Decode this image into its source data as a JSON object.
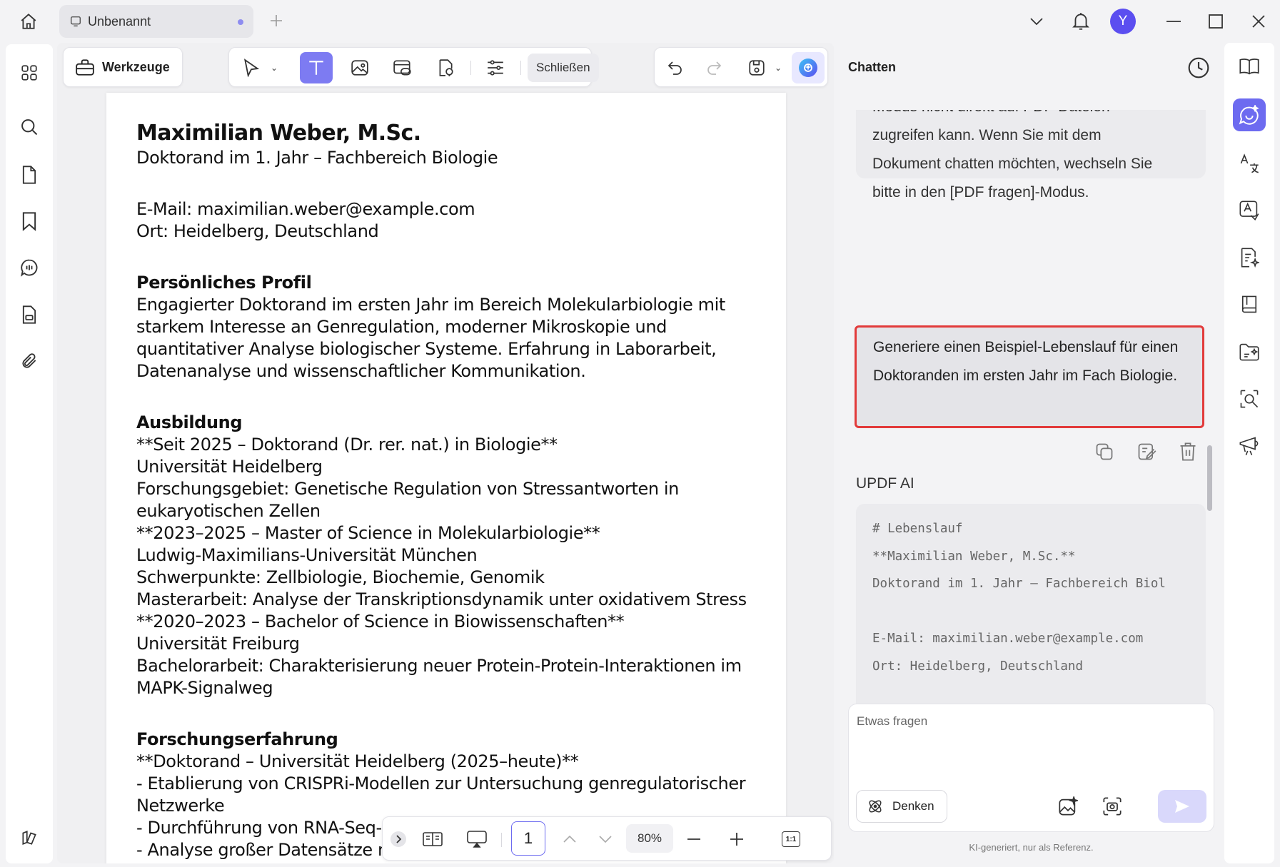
{
  "tab": {
    "title": "Unbenannt"
  },
  "topbar": {
    "avatar_letter": "Y"
  },
  "toolbar": {
    "tools_label": "Werkzeuge",
    "close_label": "Schließen"
  },
  "document": {
    "name": "Maximilian Weber, M.Sc.",
    "subtitle": "Doktorand im 1. Jahr – Fachbereich Biologie",
    "email": "E-Mail: maximilian.weber@example.com",
    "location": "Ort: Heidelberg, Deutschland",
    "profile_heading": "Persönliches Profil",
    "profile_lines": [
      "Engagierter Doktorand im ersten Jahr im Bereich Molekularbiologie mit",
      "starkem Interesse an Genregulation, moderner Mikroskopie und",
      "quantitativer Analyse biologischer Systeme. Erfahrung in Laborarbeit,",
      "Datenanalyse und wissenschaftlicher Kommunikation."
    ],
    "education_heading": "Ausbildung",
    "education_lines": [
      "**Seit 2025 – Doktorand (Dr. rer. nat.) in Biologie**",
      "Universität Heidelberg",
      "Forschungsgebiet: Genetische Regulation von Stressantworten in",
      "eukaryotischen Zellen",
      "**2023–2025 – Master of Science in Molekularbiologie**",
      "Ludwig-Maximilians-Universität München",
      "Schwerpunkte: Zellbiologie, Biochemie, Genomik",
      "Masterarbeit: Analyse der Transkriptionsdynamik unter oxidativem Stress",
      "**2020–2023 – Bachelor of Science in Biowissenschaften**",
      "Universität Freiburg",
      "Bachelorarbeit: Charakterisierung neuer Protein-Protein-Interaktionen im",
      "MAPK-Signalweg"
    ],
    "research_heading": "Forschungserfahrung",
    "research_lines": [
      "**Doktorand – Universität Heidelberg (2025–heute)**",
      "- Etablierung von CRISPRi-Modellen zur Untersuchung genregulatorischer",
      "Netzwerke",
      "- Durchführung von RNA-Seq-",
      "- Analyse großer Datensätze m"
    ]
  },
  "bottombar": {
    "page_number": "1",
    "zoom": "80%",
    "fit_label": "1:1"
  },
  "chat": {
    "title": "Chatten",
    "ai_message_lines": [
      "Modus nicht direkt auf PDF-Dateien",
      "zugreifen kann. Wenn Sie mit dem",
      "Dokument chatten möchten, wechseln Sie",
      "bitte in den [PDF fragen]-Modus."
    ],
    "user_message": "Generiere einen Beispiel-Lebenslauf für einen Doktoranden im ersten Jahr im Fach Biologie.",
    "ai_label": "UPDF AI",
    "code_lines": [
      "# Lebenslauf",
      "**Maximilian Weber, M.Sc.**",
      "Doktorand im 1. Jahr – Fachbereich Biol",
      "",
      "E-Mail: maximilian.weber@example.com",
      "Ort: Heidelberg, Deutschland",
      "",
      "---"
    ],
    "input_placeholder": "Etwas fragen",
    "think_label": "Denken",
    "footnote": "KI-generiert, nur als Referenz."
  },
  "colors": {
    "accent": "#6d6bf0",
    "highlight_border": "#e23a3a"
  }
}
